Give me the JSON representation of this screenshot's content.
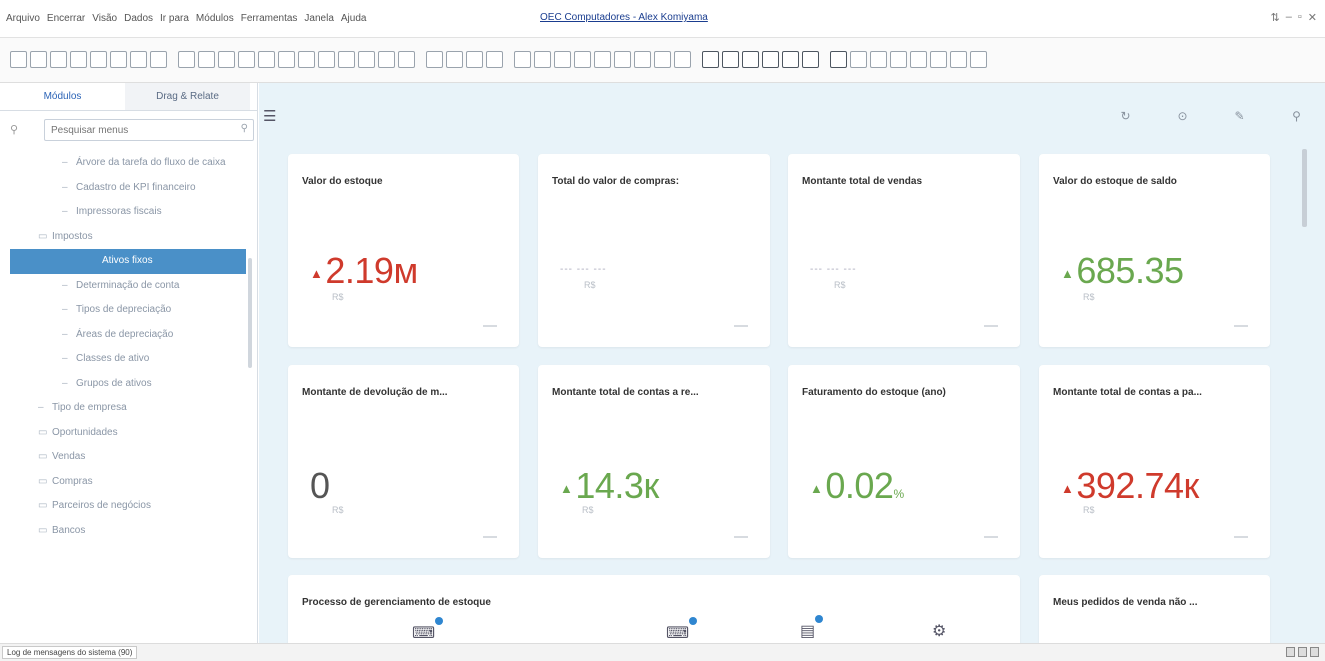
{
  "menu": [
    "Arquivo",
    "Encerrar",
    "Visão",
    "Dados",
    "Ir para",
    "Módulos",
    "Ferramentas",
    "Janela",
    "Ajuda"
  ],
  "window_title": "OEC Computadores - Alex Komiyama",
  "window_controls": [
    "⇅",
    "–",
    "▫",
    "✕"
  ],
  "sidebar": {
    "tabs": [
      {
        "label": "Módulos",
        "active": true
      },
      {
        "label": "Drag & Relate",
        "active": false
      }
    ],
    "search_placeholder": "Pesquisar menus",
    "tree": [
      {
        "label": "Árvore da tarefa do fluxo de caixa",
        "level": "l2",
        "icon": "–"
      },
      {
        "label": "Cadastro de KPI financeiro",
        "level": "l2",
        "icon": "–"
      },
      {
        "label": "Impressoras fiscais",
        "level": "l2",
        "icon": "–"
      },
      {
        "label": "Impostos",
        "level": "l1",
        "icon": "▭"
      },
      {
        "label": "Ativos fixos",
        "level": "selected",
        "icon": ""
      },
      {
        "label": "Determinação de conta",
        "level": "l2",
        "icon": "–"
      },
      {
        "label": "Tipos de depreciação",
        "level": "l2",
        "icon": "–"
      },
      {
        "label": "Áreas de depreciação",
        "level": "l2",
        "icon": "–"
      },
      {
        "label": "Classes de ativo",
        "level": "l2",
        "icon": "–"
      },
      {
        "label": "Grupos de ativos",
        "level": "l2",
        "icon": "–"
      },
      {
        "label": "Tipo de empresa",
        "level": "l1",
        "icon": "–"
      },
      {
        "label": "Oportunidades",
        "level": "l0",
        "icon": "▭"
      },
      {
        "label": "Vendas",
        "level": "l0",
        "icon": "▭"
      },
      {
        "label": "Compras",
        "level": "l0",
        "icon": "▭"
      },
      {
        "label": "Parceiros de negócios",
        "level": "l0",
        "icon": "▭"
      },
      {
        "label": "Bancos",
        "level": "l0",
        "icon": "▭"
      }
    ]
  },
  "main": {
    "menu_icon": "☰",
    "tool_icons": [
      "↻",
      "⊙",
      "✎",
      "⚲"
    ],
    "cards": [
      {
        "title": "Valor do estoque",
        "value": "2.19м",
        "color": "red",
        "arrow": "▲",
        "unit": "R$"
      },
      {
        "title": "Total do valor de compras:",
        "value": "",
        "dash": "--- --- ---",
        "unit": "R$"
      },
      {
        "title": "Montante total de vendas",
        "value": "",
        "dash": "--- --- ---",
        "unit": "R$"
      },
      {
        "title": "Valor do estoque de saldo",
        "value": "685.35",
        "color": "green",
        "arrow": "▲",
        "unit": "R$"
      },
      {
        "title": "Montante de devolução de m...",
        "value": "0",
        "color": "gray",
        "arrow": "",
        "unit": "R$"
      },
      {
        "title": "Montante total de contas a re...",
        "value": "14.3к",
        "color": "green",
        "arrow": "▲",
        "unit": "R$"
      },
      {
        "title": "Faturamento do estoque (ano)",
        "value": "0.02",
        "color": "green",
        "arrow": "▲",
        "unit": "",
        "suffix": "%"
      },
      {
        "title": "Montante total de contas a pa...",
        "value": "392.74к",
        "color": "red",
        "arrow": "▲",
        "unit": "R$"
      }
    ],
    "process_card_title": "Processo de gerenciamento de estoque",
    "orders_card_title": "Meus pedidos de venda não ..."
  },
  "status": {
    "message": "Log de mensagens do sistema (90)"
  }
}
